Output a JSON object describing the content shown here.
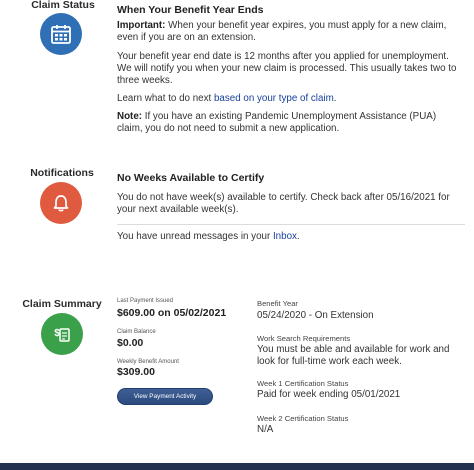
{
  "claim_status": {
    "label": "Claim Status",
    "icon": "calendar-icon",
    "color": "#2e6fb6",
    "title": "When Your Benefit Year Ends",
    "important_label": "Important:",
    "important_text": " When your benefit year expires, you must apply for a new claim, even if you are on an extension.",
    "end_date_text": "Your benefit year end date is 12 months after you applied for unemployment. We will notify you when your new claim is processed. This usually takes two to three weeks.",
    "learn_prefix": "Learn what to do next ",
    "learn_link": "based on your type of claim",
    "learn_suffix": ".",
    "note_label": "Note:",
    "note_text": " If you have an existing Pandemic Unemployment Assistance (PUA) claim, you do not need to submit a new application."
  },
  "notifications": {
    "label": "Notifications",
    "icon": "bell-icon",
    "color": "#e05a3f",
    "title": "No Weeks Available to Certify",
    "message": "You do not have week(s) available to certify. Check back after 05/16/2021 for your next available week(s).",
    "unread_prefix": "You have unread messages in your ",
    "inbox_link": "Inbox",
    "unread_suffix": "."
  },
  "claim_summary": {
    "label": "Claim Summary",
    "icon": "document-dollar-icon",
    "color": "#3aa04a",
    "last_payment_label": "Last Payment Issued",
    "last_payment_value": "$609.00 on 05/02/2021",
    "claim_balance_label": "Claim Balance",
    "claim_balance_value": "$0.00",
    "weekly_benefit_label": "Weekly Benefit Amount",
    "weekly_benefit_value": "$309.00",
    "view_payment_button": "View Payment Activity",
    "benefit_year_label": "Benefit Year",
    "benefit_year_value": "05/24/2020 - On Extension",
    "work_search_label": "Work Search Requirements",
    "work_search_value": "You must be able and available for work and look for full-time work each week.",
    "week1_label": "Week 1 Certification Status",
    "week1_value": "Paid for week ending 05/01/2021",
    "week2_label": "Week 2 Certification Status",
    "week2_value": "N/A"
  }
}
